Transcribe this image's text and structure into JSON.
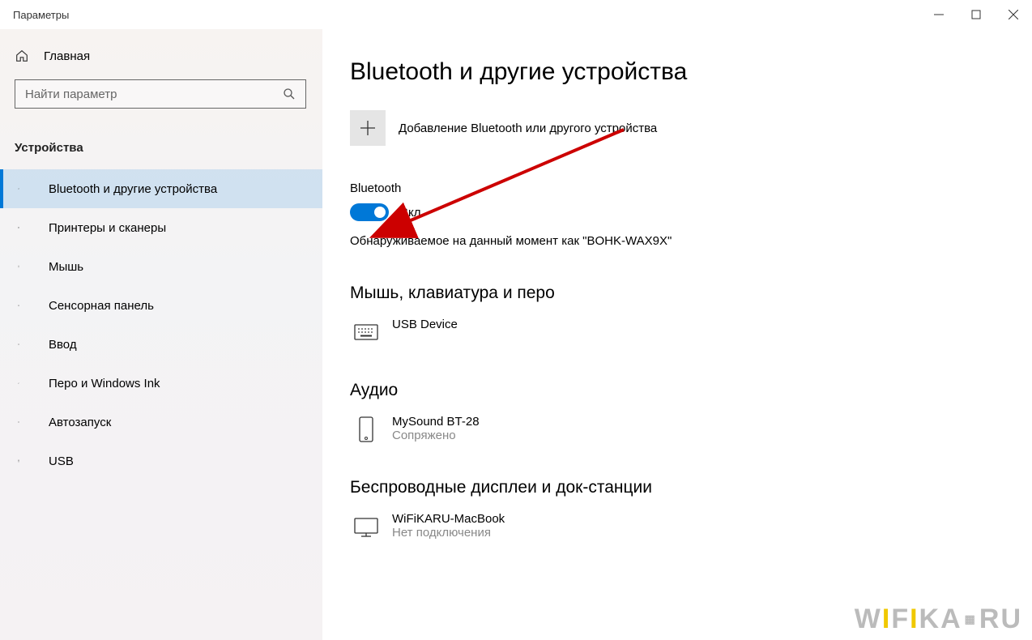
{
  "titlebar": {
    "title": "Параметры"
  },
  "sidebar": {
    "home_label": "Главная",
    "search_placeholder": "Найти параметр",
    "section_title": "Устройства",
    "items": [
      {
        "label": "Bluetooth и другие устройства",
        "icon": "bluetooth"
      },
      {
        "label": "Принтеры и сканеры",
        "icon": "printer"
      },
      {
        "label": "Мышь",
        "icon": "mouse"
      },
      {
        "label": "Сенсорная панель",
        "icon": "touchpad"
      },
      {
        "label": "Ввод",
        "icon": "keyboard"
      },
      {
        "label": "Перо и Windows Ink",
        "icon": "pen"
      },
      {
        "label": "Автозапуск",
        "icon": "autoplay"
      },
      {
        "label": "USB",
        "icon": "usb"
      }
    ]
  },
  "main": {
    "page_title": "Bluetooth и другие устройства",
    "add_device_label": "Добавление Bluetooth или другого устройства",
    "bluetooth_label": "Bluetooth",
    "bluetooth_toggle_on": true,
    "bluetooth_toggle_text": "Вкл.",
    "discoverable_text": "Обнаруживаемое на данный момент как \"BOHK-WAX9X\"",
    "sections": [
      {
        "title": "Мышь, клавиатура и перо",
        "devices": [
          {
            "name": "USB Device",
            "status": "",
            "icon": "keyboard"
          }
        ]
      },
      {
        "title": "Аудио",
        "devices": [
          {
            "name": "MySound BT-28",
            "status": "Сопряжено",
            "icon": "phone"
          }
        ]
      },
      {
        "title": "Беспроводные дисплеи и док-станции",
        "devices": [
          {
            "name": "WiFiKARU-MacBook",
            "status": "Нет подключения",
            "icon": "monitor"
          }
        ]
      }
    ]
  },
  "watermark": "WIFIKA.RU"
}
